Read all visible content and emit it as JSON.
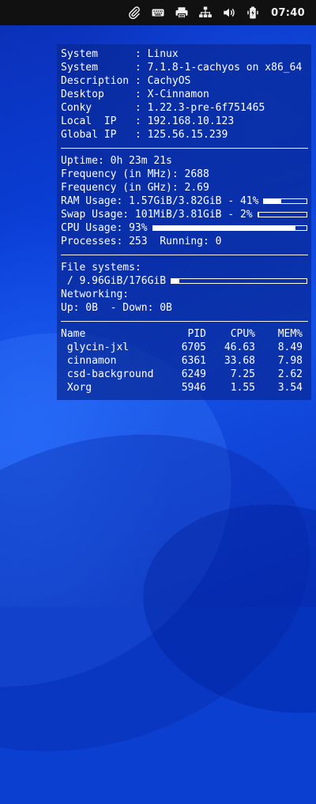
{
  "panel": {
    "clock": "07:40",
    "tray_icons": [
      "paperclip-icon",
      "keyboard-icon",
      "printer-icon",
      "network-icon",
      "volume-icon",
      "battery-icon"
    ]
  },
  "conky": {
    "info": [
      {
        "label": "System     ",
        "value": "Linux"
      },
      {
        "label": "System     ",
        "value": "7.1.8-1-cachyos on x86_64"
      },
      {
        "label": "Description",
        "value": "CachyOS"
      },
      {
        "label": "Desktop    ",
        "value": "X-Cinnamon"
      },
      {
        "label": "Conky      ",
        "value": "1.22.3-pre-6f751465"
      },
      {
        "label": "Local  IP  ",
        "value": "192.168.10.123"
      },
      {
        "label": "Global IP  ",
        "value": "125.56.15.239"
      }
    ],
    "uptime": "Uptime: 0h 23m 21s",
    "freq_mhz": "Frequency (in MHz): 2688",
    "freq_ghz": "Frequency (in GHz): 2.69",
    "ram": {
      "text": "RAM Usage: 1.57GiB/3.82GiB - 41%",
      "percent": 41
    },
    "swap": {
      "text": "Swap Usage: 101MiB/3.81GiB - 2%",
      "percent": 2
    },
    "cpu": {
      "text": "CPU Usage: 93%",
      "percent": 93
    },
    "processes": "Processes: 253  Running: 0",
    "filesystems_label": "File systems:",
    "root_fs": {
      "text": " / 9.96GiB/176GiB",
      "percent": 6
    },
    "networking_label": "Networking:",
    "net": "Up: 0B  - Down: 0B",
    "proc_headers": {
      "name": "Name",
      "pid": "PID",
      "cpu": "CPU%",
      "mem": "MEM%"
    },
    "processes_list": [
      {
        "name": " glycin-jxl",
        "pid": "6705",
        "cpu": "46.63",
        "mem": "8.49"
      },
      {
        "name": " cinnamon",
        "pid": "6361",
        "cpu": "33.68",
        "mem": "7.98"
      },
      {
        "name": " csd-background",
        "pid": "6249",
        "cpu": "7.25",
        "mem": "2.62"
      },
      {
        "name": " Xorg",
        "pid": "5946",
        "cpu": "1.55",
        "mem": "3.54"
      }
    ]
  }
}
